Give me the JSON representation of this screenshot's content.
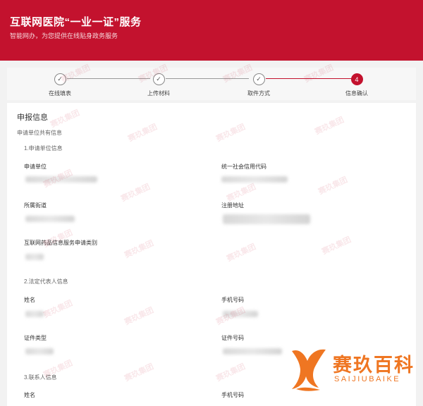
{
  "header": {
    "title": "互联网医院“一业一证”服务",
    "subtitle": "智能网办，为您提供在线贴身政务服务"
  },
  "steps": [
    {
      "label": "在线填表",
      "state": "done"
    },
    {
      "label": "上传材料",
      "state": "done"
    },
    {
      "label": "取件方式",
      "state": "done"
    },
    {
      "label": "信息确认",
      "state": "active",
      "number": "4"
    }
  ],
  "panel": {
    "title": "申报信息",
    "shared_label": "申请单位共有信息",
    "groups": [
      {
        "title": "1.申请单位信息",
        "fields": [
          {
            "label": "申请单位"
          },
          {
            "label": "统一社会信用代码"
          },
          {
            "label": "所属街道"
          },
          {
            "label": "注册地址"
          },
          {
            "label": "互联网药品信息服务申请类别"
          }
        ]
      },
      {
        "title": "2.法定代表人信息",
        "fields": [
          {
            "label": "姓名"
          },
          {
            "label": "手机号码"
          },
          {
            "label": "证件类型"
          },
          {
            "label": "证件号码"
          }
        ]
      },
      {
        "title": "3.联系人信息",
        "fields": [
          {
            "label": "姓名"
          },
          {
            "label": "手机号码"
          }
        ]
      }
    ]
  },
  "watermark": {
    "text": "赛玖集团"
  },
  "logo": {
    "brand": "赛玖百科",
    "pinyin": "SAIJIUBAIKE",
    "color": "#ef7622"
  },
  "colors": {
    "accent": "#c3122e"
  }
}
